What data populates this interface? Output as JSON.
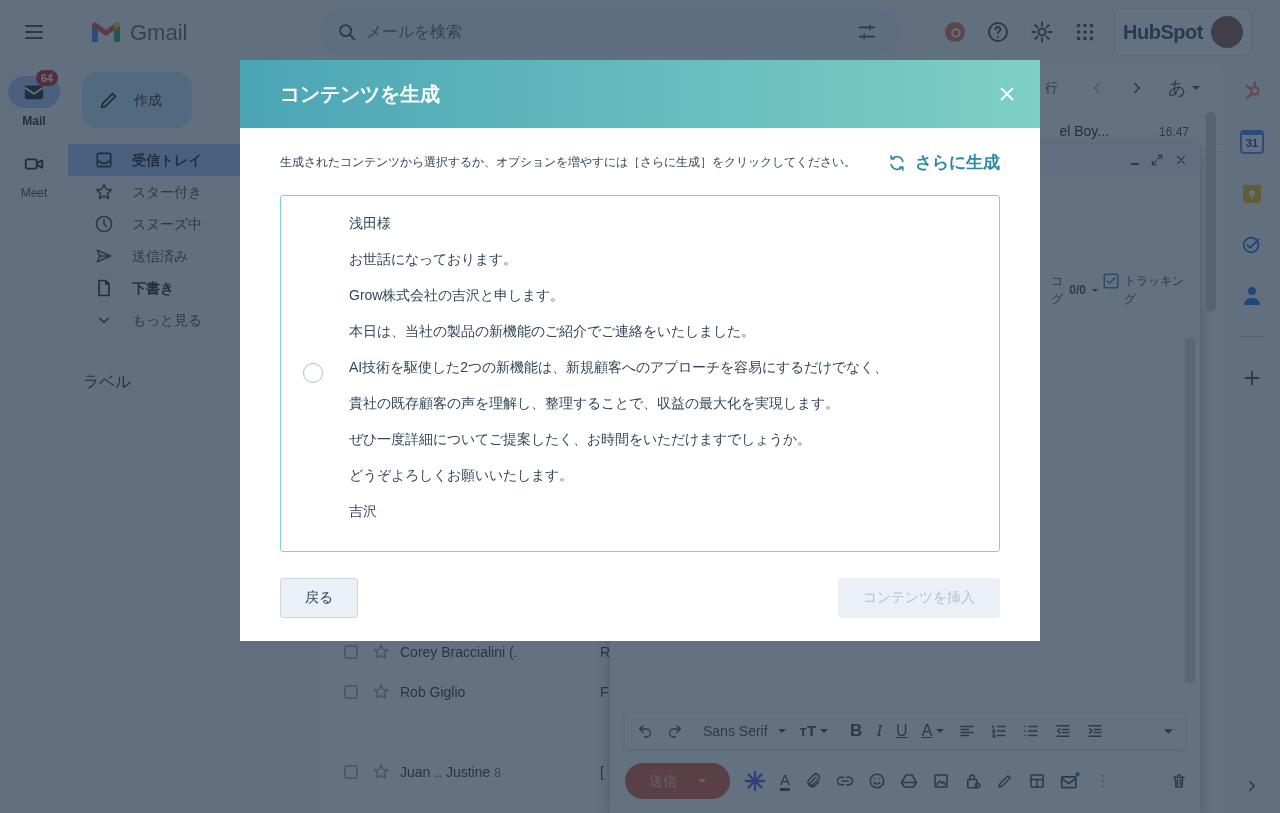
{
  "top_bar": {
    "logo_text": "Gmail",
    "search": {
      "placeholder": "メールを検索"
    },
    "brand": "HubSpot"
  },
  "rail": [
    {
      "kind": "mail",
      "label": "Mail",
      "badge": "64",
      "selected": true
    },
    {
      "kind": "meet",
      "label": "Meet",
      "selected": false
    }
  ],
  "compose_button": "作成",
  "nav": [
    {
      "kind": "inbox",
      "label": "受信トレイ",
      "selected": true,
      "unread": true
    },
    {
      "kind": "starred",
      "label": "スター付き",
      "selected": false,
      "unread": false
    },
    {
      "kind": "snoozed",
      "label": "スヌーズ中",
      "selected": false,
      "unread": false
    },
    {
      "kind": "sent",
      "label": "送信済み",
      "selected": false,
      "unread": false
    },
    {
      "kind": "drafts",
      "label": "下書き",
      "selected": false,
      "unread": true
    },
    {
      "kind": "more",
      "label": "もっと見る",
      "selected": false,
      "unread": false
    }
  ],
  "labels_heading": "ラベル",
  "list_toolbar": {
    "range_text": "行",
    "input_mode": "あ"
  },
  "rows": [
    {
      "kind": "top",
      "sender": "el Boy...",
      "time": "16:47"
    },
    {
      "kind": "left",
      "sender": "Corey Braccialini (.",
      "subject": "R"
    },
    {
      "kind": "left",
      "sender": "Rob Giglio",
      "subject": "F"
    },
    {
      "kind": "gap"
    },
    {
      "kind": "left",
      "sender": "Juan .. Justine",
      "count": "8",
      "subject": "["
    }
  ],
  "compose": {
    "logging_lines": [
      "コ",
      "グ"
    ],
    "counter": "0/0",
    "tracking": {
      "label": "トラッキング",
      "checked": true
    },
    "font": "Sans Serif",
    "toolbar_glyphs": [
      "тT",
      "B",
      "I",
      "U",
      "A"
    ],
    "text_color_glyph": "A",
    "send": "送信"
  },
  "side_panel": {
    "calendar_day": "31"
  },
  "dialog": {
    "title": "コンテンツを生成",
    "instruction": "生成されたコンテンツから選択するか、オプションを増やすには［さらに生成］をクリックしてください。",
    "regenerate": "さらに生成",
    "options": [
      {
        "selected": false,
        "lines": [
          "浅田様",
          "お世話になっております。",
          "Grow株式会社の吉沢と申します。",
          "本日は、当社の製品の新機能のご紹介でご連絡をいたしました。",
          "AI技術を駆使した2つの新機能は、新規顧客へのアプローチを容易にするだけでなく、",
          "貴社の既存顧客の声を理解し、整理することで、収益の最大化を実現します。",
          "ぜひ一度詳細についてご提案したく、お時間をいただけますでしょうか。",
          "どうぞよろしくお願いいたします。",
          "吉沢"
        ]
      }
    ],
    "back": "戻る",
    "insert": {
      "label": "コンテンツを挿入",
      "disabled": true
    }
  }
}
